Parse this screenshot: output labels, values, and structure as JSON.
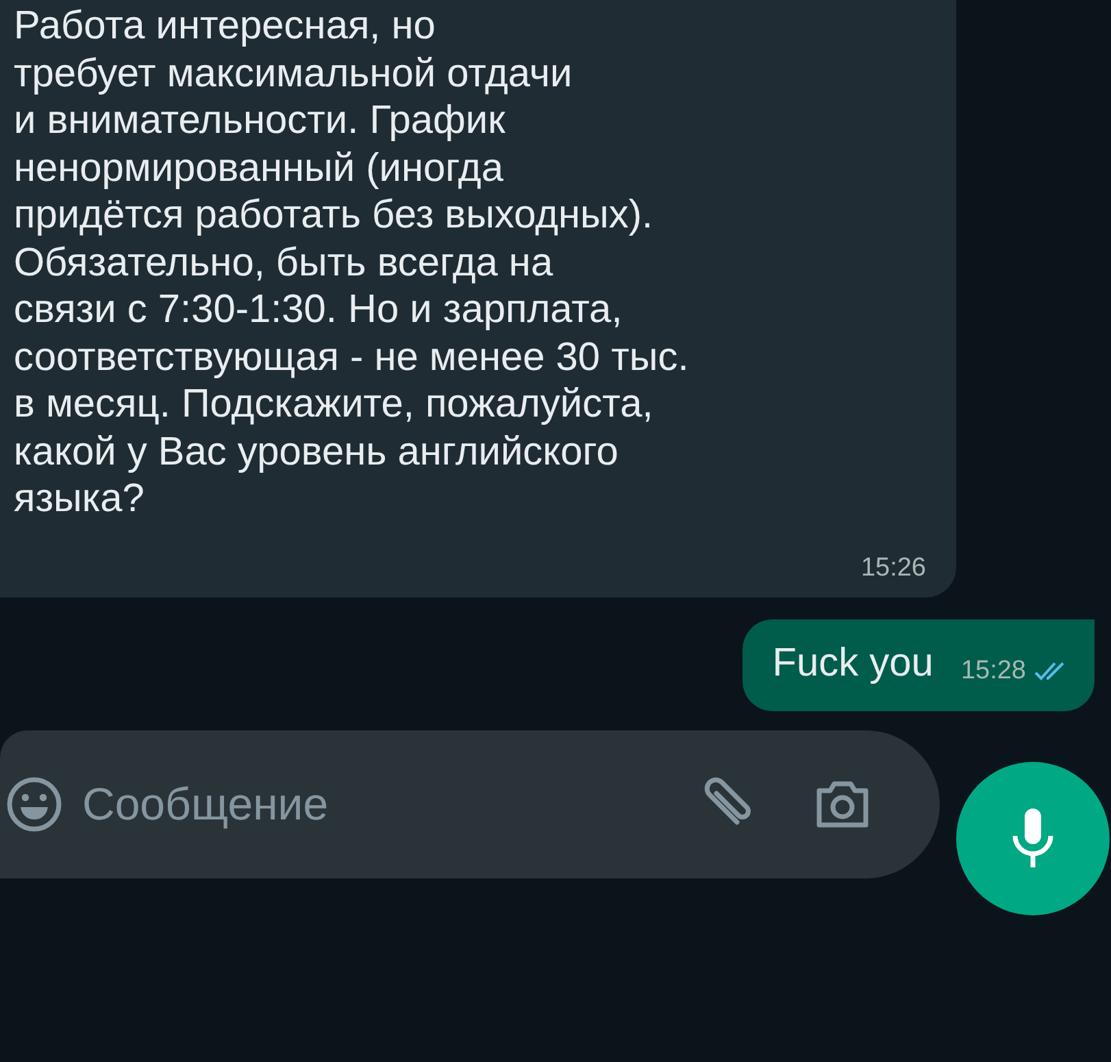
{
  "messages": [
    {
      "kind": "incoming",
      "text": "Работа интересная, но\nтребует максимальной отдачи\nи внимательности. График\nненормированный (иногда\nпридётся работать без выходных).\nОбязательно, быть всегда на\nсвязи с 7:30-1:30. Но и зарплата,\nсоответствующая - не менее 30 тыс.\nв месяц. Подскажите, пожалуйста,\nкакой у Вас уровень английского\nязыка?",
      "time": "15:26"
    },
    {
      "kind": "outgoing",
      "text": "Fuck you",
      "time": "15:28",
      "read": true
    }
  ],
  "composer": {
    "placeholder": "Сообщение"
  }
}
